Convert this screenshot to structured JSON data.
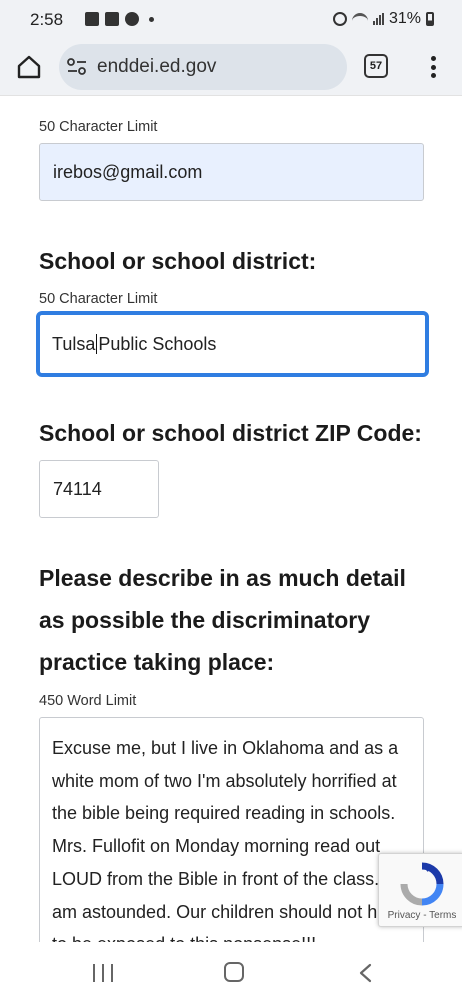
{
  "status_bar": {
    "time": "2:58",
    "battery": "31%",
    "icons": [
      "gallery-icon",
      "caption-icon",
      "chrome-icon",
      "dot-icon",
      "alarm-icon",
      "wifi-icon",
      "signal-icon",
      "battery-icon"
    ]
  },
  "browser": {
    "url": "enddei.ed.gov",
    "tab_count": "57",
    "icons": [
      "home-icon",
      "tune-icon",
      "tabs-icon",
      "more-icon"
    ]
  },
  "form": {
    "email": {
      "limit": "50 Character Limit",
      "value": "irebos@gmail.com"
    },
    "school": {
      "heading": "School or school district:",
      "limit": "50 Character Limit",
      "value_before_caret": "Tulsa",
      "value_after_caret": "Public Schools"
    },
    "zip": {
      "heading": "School or school district ZIP Code:",
      "value": "74114"
    },
    "description": {
      "heading_line1": "Please describe in as much detail",
      "heading_line2": "as possible the discriminatory",
      "heading_line3": "practice taking place:",
      "limit": "450 Word Limit",
      "text": "Excuse me, but I live in Oklahoma and as a white mom of two I'm absolutely horrified at the bible being required reading in schools. Mrs. Fullofit on Monday morning read out LOUD from the Bible in front of the class. I am astounded. Our children should not have to be exposed to this nonsense!!!"
    }
  },
  "recaptcha": {
    "links": "Privacy - Terms"
  },
  "nav": {
    "icons": [
      "recents-icon",
      "home-icon",
      "back-icon"
    ]
  },
  "colors": {
    "focus_border": "#2f7de1",
    "autofill_bg": "#e8f0fe",
    "spellcheck_underline": "#3aa2d6",
    "chrome_bar": "#f0f2f5"
  }
}
